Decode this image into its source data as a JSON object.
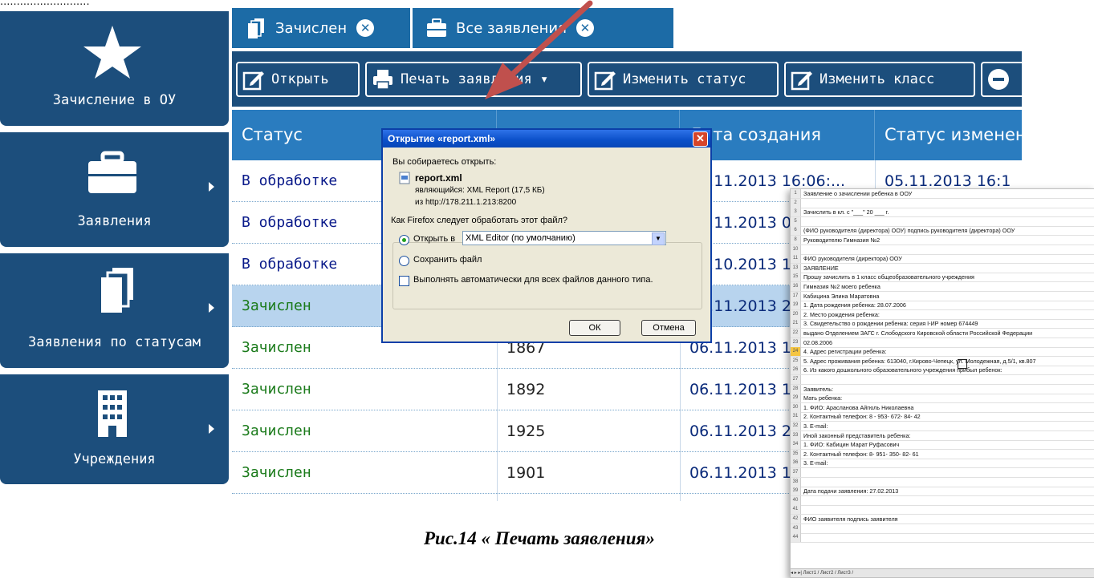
{
  "sidebar": {
    "items": [
      {
        "label": "Зачисление в ОУ",
        "icon": "star-icon"
      },
      {
        "label": "Заявления",
        "icon": "briefcase-icon"
      },
      {
        "label": "Заявления по статусам",
        "icon": "stacked-pages-icon"
      },
      {
        "label": "Учреждения",
        "icon": "building-icon"
      }
    ]
  },
  "tabs": [
    {
      "label": "Зачислен",
      "icon": "stacked-pages-icon"
    },
    {
      "label": "Все заявления",
      "icon": "briefcase-icon"
    }
  ],
  "toolbar": {
    "open": "Открыть",
    "print": "Печать заявления ▾",
    "change_status": "Изменить статус",
    "change_class": "Изменить класс"
  },
  "table": {
    "headers": {
      "status": "Статус",
      "created": "Дата создания",
      "status_changed": "Статус изменен"
    },
    "rows": [
      {
        "status": "В обработке",
        "id": "",
        "created": "05.11.2013 16:06:...",
        "changed": "05.11.2013 16:1"
      },
      {
        "status": "В обработке",
        "id": "",
        "created": "05.11.2013 0",
        "changed": ""
      },
      {
        "status": "В обработке",
        "id": "",
        "created": "30.10.2013 1",
        "changed": ""
      },
      {
        "status": "Зачислен",
        "id": "",
        "created": "06.11.2013 2",
        "changed": ""
      },
      {
        "status": "Зачислен",
        "id": "1867",
        "created": "06.11.2013 1",
        "changed": ""
      },
      {
        "status": "Зачислен",
        "id": "1892",
        "created": "06.11.2013 1",
        "changed": ""
      },
      {
        "status": "Зачислен",
        "id": "1925",
        "created": "06.11.2013 2",
        "changed": ""
      },
      {
        "status": "Зачислен",
        "id": "1901",
        "created": "06.11.2013 1",
        "changed": ""
      }
    ]
  },
  "dialog": {
    "title": "Открытие «report.xml»",
    "prompt": "Вы собираетесь открыть:",
    "filename": "report.xml",
    "type_line": "являющийся: XML Report (17,5 КБ)",
    "from_line": "из http://178.211.1.213:8200",
    "question": "Как Firefox следует обработать этот файл?",
    "open_with_label": "Открыть в",
    "open_with_value": "XML Editor (по умолчанию)",
    "save_label": "Сохранить файл",
    "auto_label": "Выполнять автоматически для всех файлов данного типа.",
    "ok": "ОК",
    "cancel": "Отмена"
  },
  "caption": "Рис.14 « Печать заявления»",
  "top_cut_text": "...........................",
  "report": {
    "lines": [
      {
        "n": "1",
        "t": "Заявление о зачислении ребенка в ООУ"
      },
      {
        "n": "2",
        "t": ""
      },
      {
        "n": "3",
        "t": "Зачислить в            кл. с \"___\"               20 ___ г."
      },
      {
        "n": "5",
        "t": ""
      },
      {
        "n": "6",
        "t": "(ФИО руководителя (директора) ООУ)          подпись руководителя (директора) ООУ"
      },
      {
        "n": "8",
        "t": "Руководителю      Гимназия №2"
      },
      {
        "n": "10",
        "t": ""
      },
      {
        "n": "11",
        "t": "                         ФИО руководителя (директора) ООУ"
      },
      {
        "n": "13",
        "t": "                                  ЗАЯВЛЕНИЕ"
      },
      {
        "n": "15",
        "t": "Прошу зачислить в 1 класс общеобразовательного учреждения"
      },
      {
        "n": "16",
        "t": "Гимназия №2                                                      моего ребенка"
      },
      {
        "n": "17",
        "t": "Кабицина Элина Маратовна"
      },
      {
        "n": "19",
        "t": "1. Дата рождения ребенка:        28.07.2006"
      },
      {
        "n": "20",
        "t": "2. Место рождения ребенка:"
      },
      {
        "n": "21",
        "t": "3. Свидетельство о рождении ребенка: серия        I-ИР      номер   674449"
      },
      {
        "n": "22",
        "t": "   выдано      Отделением ЗАГС г. Слободского Кировской области Российской Федерации"
      },
      {
        "n": "23",
        "t": "   02.08.2006"
      },
      {
        "n": "24",
        "t": "4. Адрес регистрации ребенка:"
      },
      {
        "n": "25",
        "t": "5. Адрес проживания ребенка:      613040, г.Кирово-Чепецк, ул. Молодежная, д.5/1, кв.807"
      },
      {
        "n": "26",
        "t": "6. Из какого дошкольного образовательного учреждения прибыл ребенок:"
      },
      {
        "n": "27",
        "t": ""
      },
      {
        "n": "28",
        "t": "Заявитель:"
      },
      {
        "n": "29",
        "t": "Мать ребенка:"
      },
      {
        "n": "30",
        "t": "1. ФИО:       Арасланова Айгюль Николаевна"
      },
      {
        "n": "31",
        "t": "2. Контактный телефон:       8 - 953- 672- 84- 42"
      },
      {
        "n": "32",
        "t": "3. E-mail:"
      },
      {
        "n": "33",
        "t": "Иной законный представитель ребенка:"
      },
      {
        "n": "34",
        "t": "1. ФИО:      Кабицин Марат Руфасович"
      },
      {
        "n": "35",
        "t": "2. Контактный телефон:       8- 951- 350- 82- 61"
      },
      {
        "n": "36",
        "t": "3. E-mail:"
      },
      {
        "n": "37",
        "t": ""
      },
      {
        "n": "38",
        "t": ""
      },
      {
        "n": "39",
        "t": "Дата подачи заявления:        27.02.2013"
      },
      {
        "n": "40",
        "t": ""
      },
      {
        "n": "41",
        "t": ""
      },
      {
        "n": "42",
        "t": "          ФИО заявителя                                    подпись заявителя"
      },
      {
        "n": "43",
        "t": ""
      },
      {
        "n": "44",
        "t": ""
      }
    ],
    "sheet_tabs": "◂ ▸ ▸| Лист1 / Лист2 / Лист3 / "
  },
  "colors": {
    "sidebar": "#1c4e7c",
    "tab": "#1c6ba6",
    "header": "#2a7cbf",
    "status_processing": "#0a1a8a",
    "status_enrolled": "#1a7a1a",
    "arrow": "#c0504d"
  }
}
